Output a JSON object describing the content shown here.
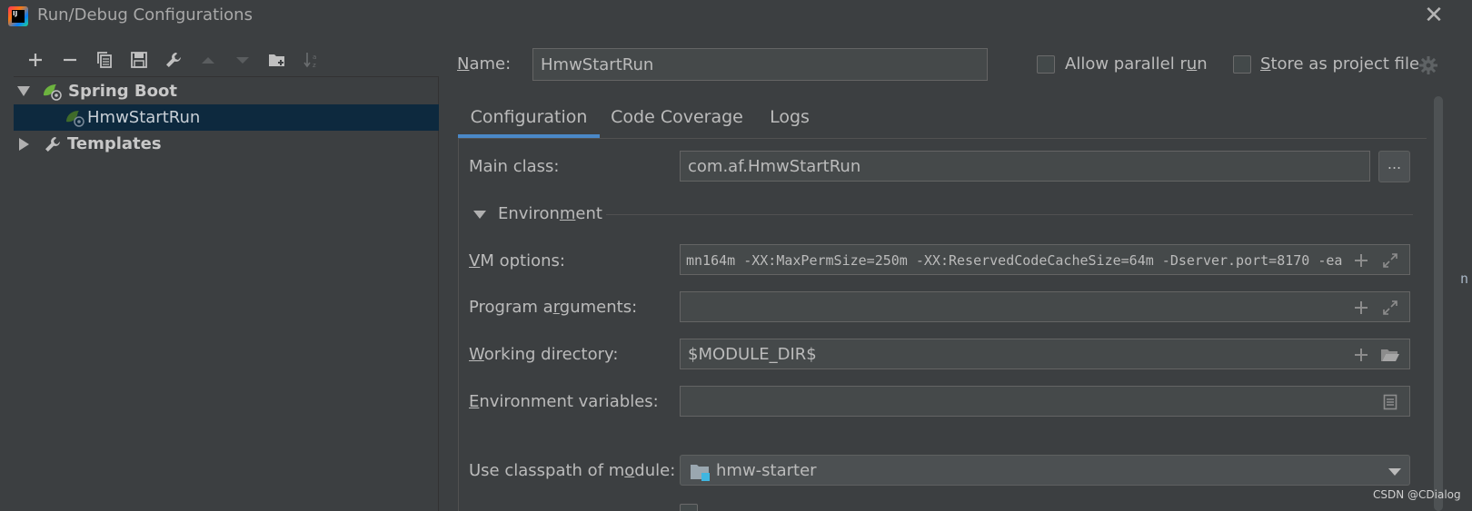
{
  "window": {
    "app_icon_text": "IJ",
    "title": "Run/Debug Configurations"
  },
  "toolbar": {
    "buttons": [
      "add-icon",
      "remove-icon",
      "copy-icon",
      "save-icon",
      "wrench-icon",
      "up-arrow-icon",
      "down-arrow-icon",
      "folder-icon",
      "sort-icon"
    ]
  },
  "tree": {
    "items": [
      {
        "label": "Spring Boot",
        "icon": "spring-boot-icon",
        "expanded": true
      },
      {
        "label": "HmwStartRun",
        "icon": "spring-boot-config-icon",
        "selected": true
      },
      {
        "label": "Templates",
        "icon": "wrench-icon",
        "expanded": false
      }
    ]
  },
  "header": {
    "name_label_u": "N",
    "name_label_rest": "ame:",
    "name_value": "HmwStartRun",
    "parallel_pre": "Allow parallel r",
    "parallel_u": "u",
    "parallel_post": "n",
    "store_u": "S",
    "store_rest": "tore as project file"
  },
  "tabs": [
    {
      "label": "Configuration",
      "active": true
    },
    {
      "label": "Code Coverage",
      "active": false
    },
    {
      "label": "Logs",
      "active": false
    }
  ],
  "form": {
    "main_class_label": "Main class:",
    "main_class_value": "com.af.HmwStartRun",
    "browse_label": "...",
    "env_pre": "Environ",
    "env_u": "m",
    "env_post": "ent",
    "vm_u": "V",
    "vm_rest": "M options:",
    "vm_value": "mn164m -XX:MaxPermSize=250m -XX:ReservedCodeCacheSize=64m -Dserver.port=8170 -ea",
    "prog_pre": "Program a",
    "prog_u": "r",
    "prog_post": "guments:",
    "prog_value": "",
    "wd_u": "W",
    "wd_rest": "orking directory:",
    "wd_value": "$MODULE_DIR$",
    "envvars_u": "E",
    "envvars_rest": "nvironment variables:",
    "envvars_value": "",
    "cp_pre": "Use classpath of m",
    "cp_u": "o",
    "cp_post": "dule:",
    "cp_value": "hmw-starter"
  },
  "edge_text": "n",
  "watermark": "CSDN @CDialog",
  "colors": {
    "background": "#3c3f41",
    "field": "#45494a",
    "selection": "#0d293e",
    "tab_accent": "#4a88c7",
    "spring_green": "#6db33f"
  }
}
